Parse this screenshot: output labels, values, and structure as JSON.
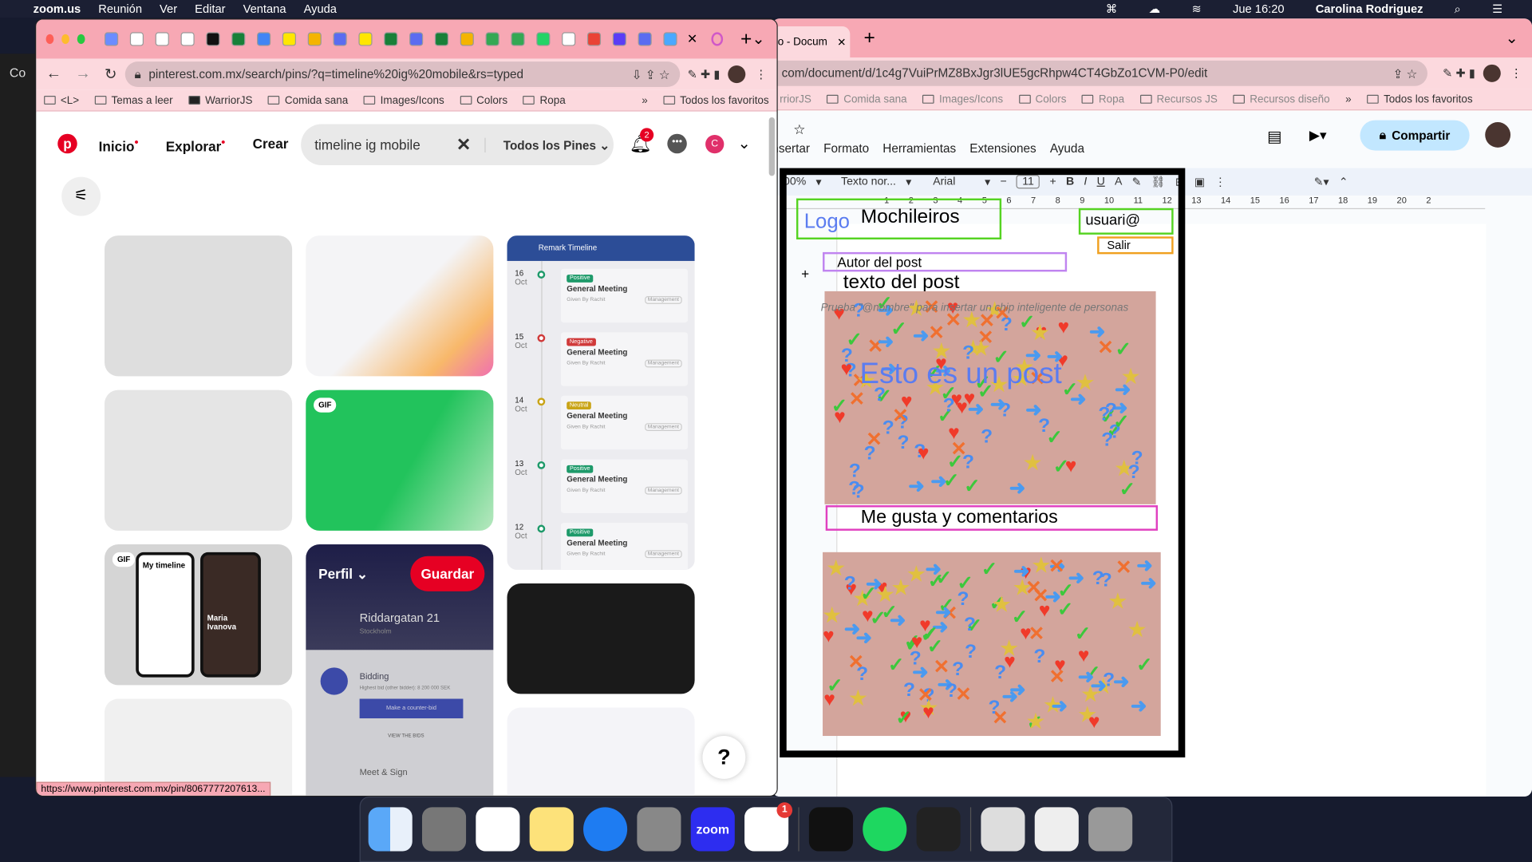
{
  "menubar": {
    "app": "zoom.us",
    "items": [
      "Reunión",
      "Ver",
      "Editar",
      "Ventana",
      "Ayuda"
    ],
    "clock": "Jue 16:20",
    "user": "Carolina Rodriguez"
  },
  "left_browser": {
    "url": "pinterest.com.mx/search/pins/?q=timeline%20ig%20mobile&rs=typed",
    "bookmarks": [
      "<L>",
      "Temas a leer",
      "WarriorJS",
      "Comida sana",
      "Images/Icons",
      "Colors",
      "Ropa"
    ],
    "bookmarks_more": "»",
    "all_bookmarks": "Todos los favoritos",
    "status_url": "https://www.pinterest.com.mx/pin/8067777207613..."
  },
  "pinterest": {
    "nav": [
      "Inicio",
      "Explorar",
      "Crear"
    ],
    "search_value": "timeline ig mobile",
    "filter": "Todos los Pines",
    "notifications": "2",
    "avatar_letter": "C",
    "gif": "GIF",
    "pin_timeline": "My timeline",
    "pin_name": "Maria Ivanova",
    "profile_label": "Perfil",
    "save_button": "Guardar",
    "bid_title": "Riddargatan 21",
    "bid_city": "Stockholm",
    "bidding": "Bidding",
    "bid_text": "Highest bid (other bidder): 8 200 000 SEK",
    "counter": "Make a counter-bid",
    "view_bids": "VIEW THE BIDS",
    "meet": "Meet & Sign",
    "remark_title": "Remark Timeline",
    "timeline": [
      {
        "day": "16",
        "month": "Oct",
        "tag": "Positive",
        "color": "#1e9a6a",
        "title": "General Meeting",
        "by": "Given By Rachit",
        "cat": "Management"
      },
      {
        "day": "15",
        "month": "Oct",
        "tag": "Negative",
        "color": "#d03a3a",
        "title": "General Meeting",
        "by": "Given By Rachit",
        "cat": "Management"
      },
      {
        "day": "14",
        "month": "Oct",
        "tag": "Neutral",
        "color": "#c9a417",
        "title": "General Meeting",
        "by": "Given By Rachit",
        "cat": "Management"
      },
      {
        "day": "13",
        "month": "Oct",
        "tag": "Positive",
        "color": "#1e9a6a",
        "title": "General Meeting",
        "by": "Given By Rachit",
        "cat": "Management"
      },
      {
        "day": "12",
        "month": "Oct",
        "tag": "Positive",
        "color": "#1e9a6a",
        "title": "General Meeting",
        "by": "Given By Rachit",
        "cat": "Management"
      }
    ],
    "help": "?"
  },
  "right_browser": {
    "tab": "o - Docum",
    "url": "com/document/d/1c4g7VuiPrMZ8BxJgr3lUE5gcRhpw4CT4GbZo1CVM-P0/edit",
    "bookmarks": [
      "rriorJS",
      "Comida sana",
      "Images/Icons",
      "Colors",
      "Ropa",
      "Recursos JS",
      "Recursos diseño"
    ],
    "bookmarks_more": "»",
    "all_bookmarks": "Todos los favoritos"
  },
  "docs": {
    "menu": [
      "nsertar",
      "Formato",
      "Herramientas",
      "Extensiones",
      "Ayuda"
    ],
    "share": "Compartir",
    "zoom": "00%",
    "style": "Texto nor...",
    "font": "Arial",
    "size": "11",
    "ruler": [
      "1",
      "2",
      "3",
      "4",
      "5",
      "6",
      "7",
      "8",
      "9",
      "10",
      "11",
      "12",
      "13",
      "14",
      "15",
      "16",
      "17",
      "18",
      "19",
      "20",
      "2"
    ],
    "logo": "Logo",
    "brand": "Mochileiros",
    "user": "usuari@",
    "logout": "Salir",
    "author": "Autor del post",
    "post_text": "texto del post",
    "hint": "Prueba \"@nombre\" para insertar un chip inteligente de personas",
    "post_overlay": "Esto es un post",
    "likes": "Me gusta y comentarios"
  },
  "dock": {
    "apps": [
      "Finder",
      "Launchpad",
      "Chrome",
      "Notes",
      "App Store",
      "System Preferences",
      "zoom",
      "Slack",
      "Terminal",
      "Spotify",
      "Figma",
      "Document",
      "Chrome window",
      "Trash"
    ],
    "slack_badge": "1"
  }
}
